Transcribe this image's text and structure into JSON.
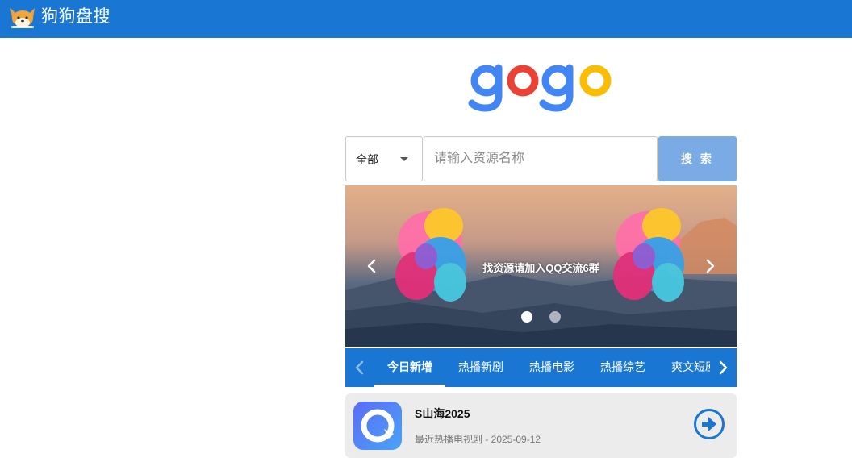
{
  "header": {
    "site_name": "狗狗盘搜",
    "logo_icon": "corgi-logo-icon",
    "background_color": "#1976d2"
  },
  "brand": {
    "logo_letters": [
      "g",
      "o",
      "g",
      "o"
    ],
    "logo_colors": [
      "#4285f4",
      "#ea4335",
      "#4285f4",
      "#fbbc05"
    ]
  },
  "search": {
    "category_selected": "全部",
    "placeholder": "请输入资源名称",
    "value": "",
    "button_label": "搜 索",
    "button_color": "#7aabe4"
  },
  "banner": {
    "caption": "找资源请加入QQ交流6群",
    "slide_count": 2,
    "active_slide": 1
  },
  "tabs": {
    "items": [
      {
        "label": "今日新增",
        "active": true
      },
      {
        "label": "热播新剧",
        "active": false
      },
      {
        "label": "热播电影",
        "active": false
      },
      {
        "label": "热播综艺",
        "active": false
      },
      {
        "label": "爽文短剧",
        "active": false
      }
    ]
  },
  "results": [
    {
      "title": "S山海2025",
      "meta": "最近热播电视剧 - 2025-09-12",
      "icon": "cloud-drive-app-icon",
      "action_icon": "arrow-right-circle-icon"
    }
  ]
}
